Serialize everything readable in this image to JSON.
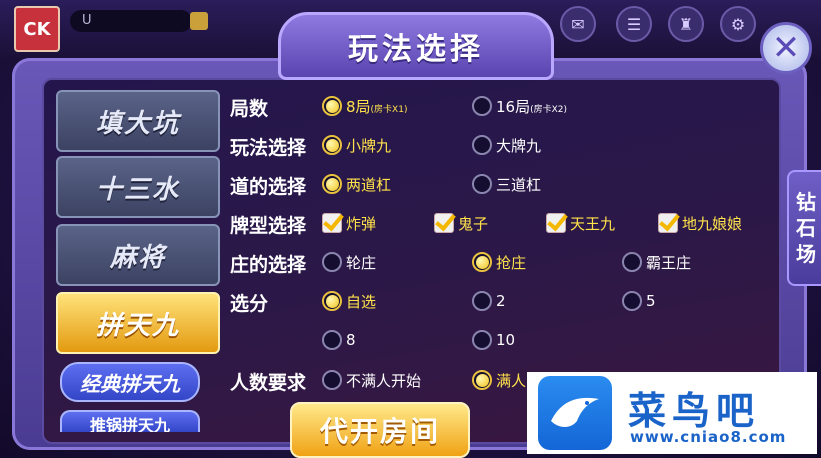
{
  "topbar": {
    "username": "U",
    "icons": [
      "mail-icon",
      "list-icon",
      "shop-icon",
      "settings-icon",
      "share-icon"
    ]
  },
  "dialog": {
    "title": "玩法选择",
    "side_tab": [
      "钻",
      "石",
      "场"
    ],
    "tabs": [
      "填大坑",
      "十三水",
      "麻将",
      "拼天九"
    ],
    "active_tab": "拼天九",
    "subtabs": [
      "经典拼天九",
      "推锅拼天九"
    ],
    "rows": [
      {
        "label": "局数",
        "type": "radio",
        "options": [
          {
            "text": "8局",
            "note": "(房卡X1)",
            "selected": true
          },
          {
            "text": "16局",
            "note": "(房卡X2)",
            "selected": false
          }
        ]
      },
      {
        "label": "玩法选择",
        "type": "radio",
        "options": [
          {
            "text": "小牌九",
            "selected": true
          },
          {
            "text": "大牌九",
            "selected": false
          }
        ]
      },
      {
        "label": "道的选择",
        "type": "radio",
        "options": [
          {
            "text": "两道杠",
            "selected": true
          },
          {
            "text": "三道杠",
            "selected": false
          }
        ]
      },
      {
        "label": "牌型选择",
        "type": "check",
        "options": [
          {
            "text": "炸弹",
            "selected": true
          },
          {
            "text": "鬼子",
            "selected": true
          },
          {
            "text": "天王九",
            "selected": true
          },
          {
            "text": "地九娘娘",
            "selected": true
          }
        ]
      },
      {
        "label": "庄的选择",
        "type": "radio",
        "options": [
          {
            "text": "轮庄",
            "selected": false
          },
          {
            "text": "抢庄",
            "selected": true
          },
          {
            "text": "霸王庄",
            "selected": false
          }
        ]
      },
      {
        "label": "选分",
        "type": "radio",
        "options": [
          {
            "text": "自选",
            "selected": true
          },
          {
            "text": "2",
            "selected": false
          },
          {
            "text": "5",
            "selected": false
          },
          {
            "text": "8",
            "selected": false
          },
          {
            "text": "10",
            "selected": false
          }
        ]
      },
      {
        "label": "人数要求",
        "type": "radio",
        "options": [
          {
            "text": "不满人开始",
            "selected": false
          },
          {
            "text": "满人",
            "selected": true
          }
        ]
      }
    ],
    "open_room_button": "代开房间"
  },
  "watermark": {
    "title": "菜鸟吧",
    "url": "www.cniao8.com"
  },
  "colors": {
    "accent_gold": "#f2c21a",
    "panel_purple": "#5a44b0",
    "watermark_blue": "#1a63c8"
  }
}
